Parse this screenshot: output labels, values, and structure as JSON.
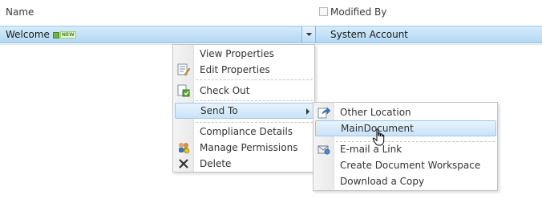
{
  "header": {
    "name": "Name",
    "modified_by": "Modified By"
  },
  "row": {
    "name": "Welcome",
    "new_badge": "NEW",
    "modified_by": "System Account"
  },
  "context_menu": {
    "items": [
      {
        "label": "View Properties",
        "icon": ""
      },
      {
        "label": "Edit Properties",
        "icon": "edit-properties-icon"
      },
      {
        "label": "Check Out",
        "icon": "check-out-icon"
      },
      {
        "label": "Send To",
        "icon": ""
      },
      {
        "label": "Compliance Details",
        "icon": ""
      },
      {
        "label": "Manage Permissions",
        "icon": "manage-permissions-icon"
      },
      {
        "label": "Delete",
        "icon": "delete-icon"
      }
    ]
  },
  "send_to_menu": {
    "items": [
      {
        "label": "Other Location",
        "icon": "other-location-icon"
      },
      {
        "label": "MainDocument",
        "icon": ""
      },
      {
        "label": "E-mail a Link",
        "icon": "email-link-icon"
      },
      {
        "label": "Create Document Workspace",
        "icon": ""
      },
      {
        "label": "Download a Copy",
        "icon": ""
      }
    ]
  },
  "colors": {
    "row_highlight": "#b2d8f4",
    "menu_highlight": "#c9e3f9",
    "badge_green": "#6cb33f"
  }
}
